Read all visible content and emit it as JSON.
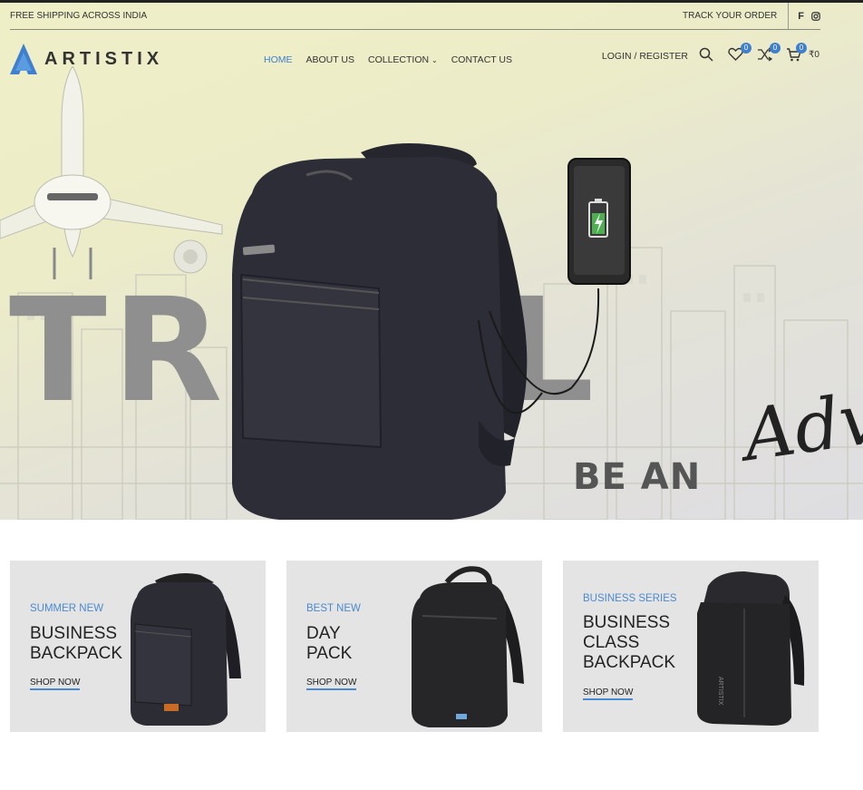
{
  "topbar": {
    "shipping_text": "FREE SHIPPING ACROSS INDIA",
    "track_text": "TRACK YOUR ORDER",
    "social_icons": [
      "facebook-icon",
      "instagram-icon"
    ]
  },
  "header": {
    "logo_text": "ARTISTIX",
    "nav": [
      {
        "label": "HOME",
        "active": true
      },
      {
        "label": "ABOUT US"
      },
      {
        "label": "COLLECTION"
      },
      {
        "label": "CONTACT US"
      }
    ],
    "login_label": "LOGIN / REGISTER",
    "wishlist_count": "0",
    "compare_count": "0",
    "cart_count": "0",
    "cart_total": "₹0"
  },
  "hero": {
    "word_travel": "TR VEL",
    "word_bean": "BE AN",
    "word_adventure": "Adve"
  },
  "cards": [
    {
      "subtitle": "SUMMER NEW",
      "title_line1": "BUSINESS",
      "title_line2": "BACKPACK",
      "title_line3": "",
      "cta": "SHOP NOW"
    },
    {
      "subtitle": "BEST NEW",
      "title_line1": "DAY",
      "title_line2": "PACK",
      "title_line3": "",
      "cta": "SHOP NOW"
    },
    {
      "subtitle": "BUSINESS SERIES",
      "title_line1": "BUSINESS",
      "title_line2": "CLASS",
      "title_line3": "BACKPACK",
      "cta": "SHOP NOW"
    }
  ],
  "colors": {
    "accent": "#3f7fcf",
    "card_bg": "#e4e4e4",
    "text_dark": "#222222"
  }
}
